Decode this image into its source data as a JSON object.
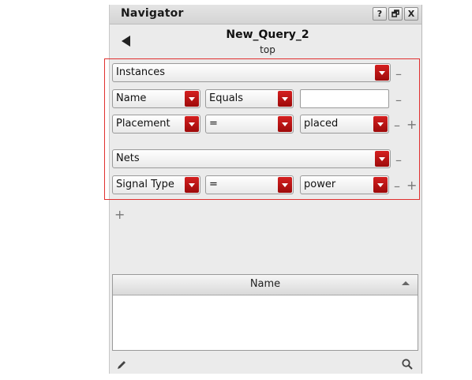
{
  "window": {
    "title": "Navigator",
    "buttons": [
      "?",
      "🗗",
      "X"
    ]
  },
  "query": {
    "name": "New_Query_2",
    "scope": "top"
  },
  "groups": [
    {
      "type": "Instances",
      "rows": [
        {
          "field": "Name",
          "operator": "Equals",
          "value": "",
          "value_is_text": true
        },
        {
          "field": "Placement",
          "operator": "=",
          "value": "placed",
          "value_is_text": false
        }
      ]
    },
    {
      "type": "Nets",
      "rows": [
        {
          "field": "Signal Type",
          "operator": "=",
          "value": "power",
          "value_is_text": false
        }
      ]
    }
  ],
  "controls": {
    "remove": "–",
    "add": "+"
  },
  "results_table": {
    "columns": [
      "Name"
    ],
    "rows": []
  },
  "colors": {
    "highlight_border": "#e0302f",
    "dropdown_accent": "#b51414"
  }
}
